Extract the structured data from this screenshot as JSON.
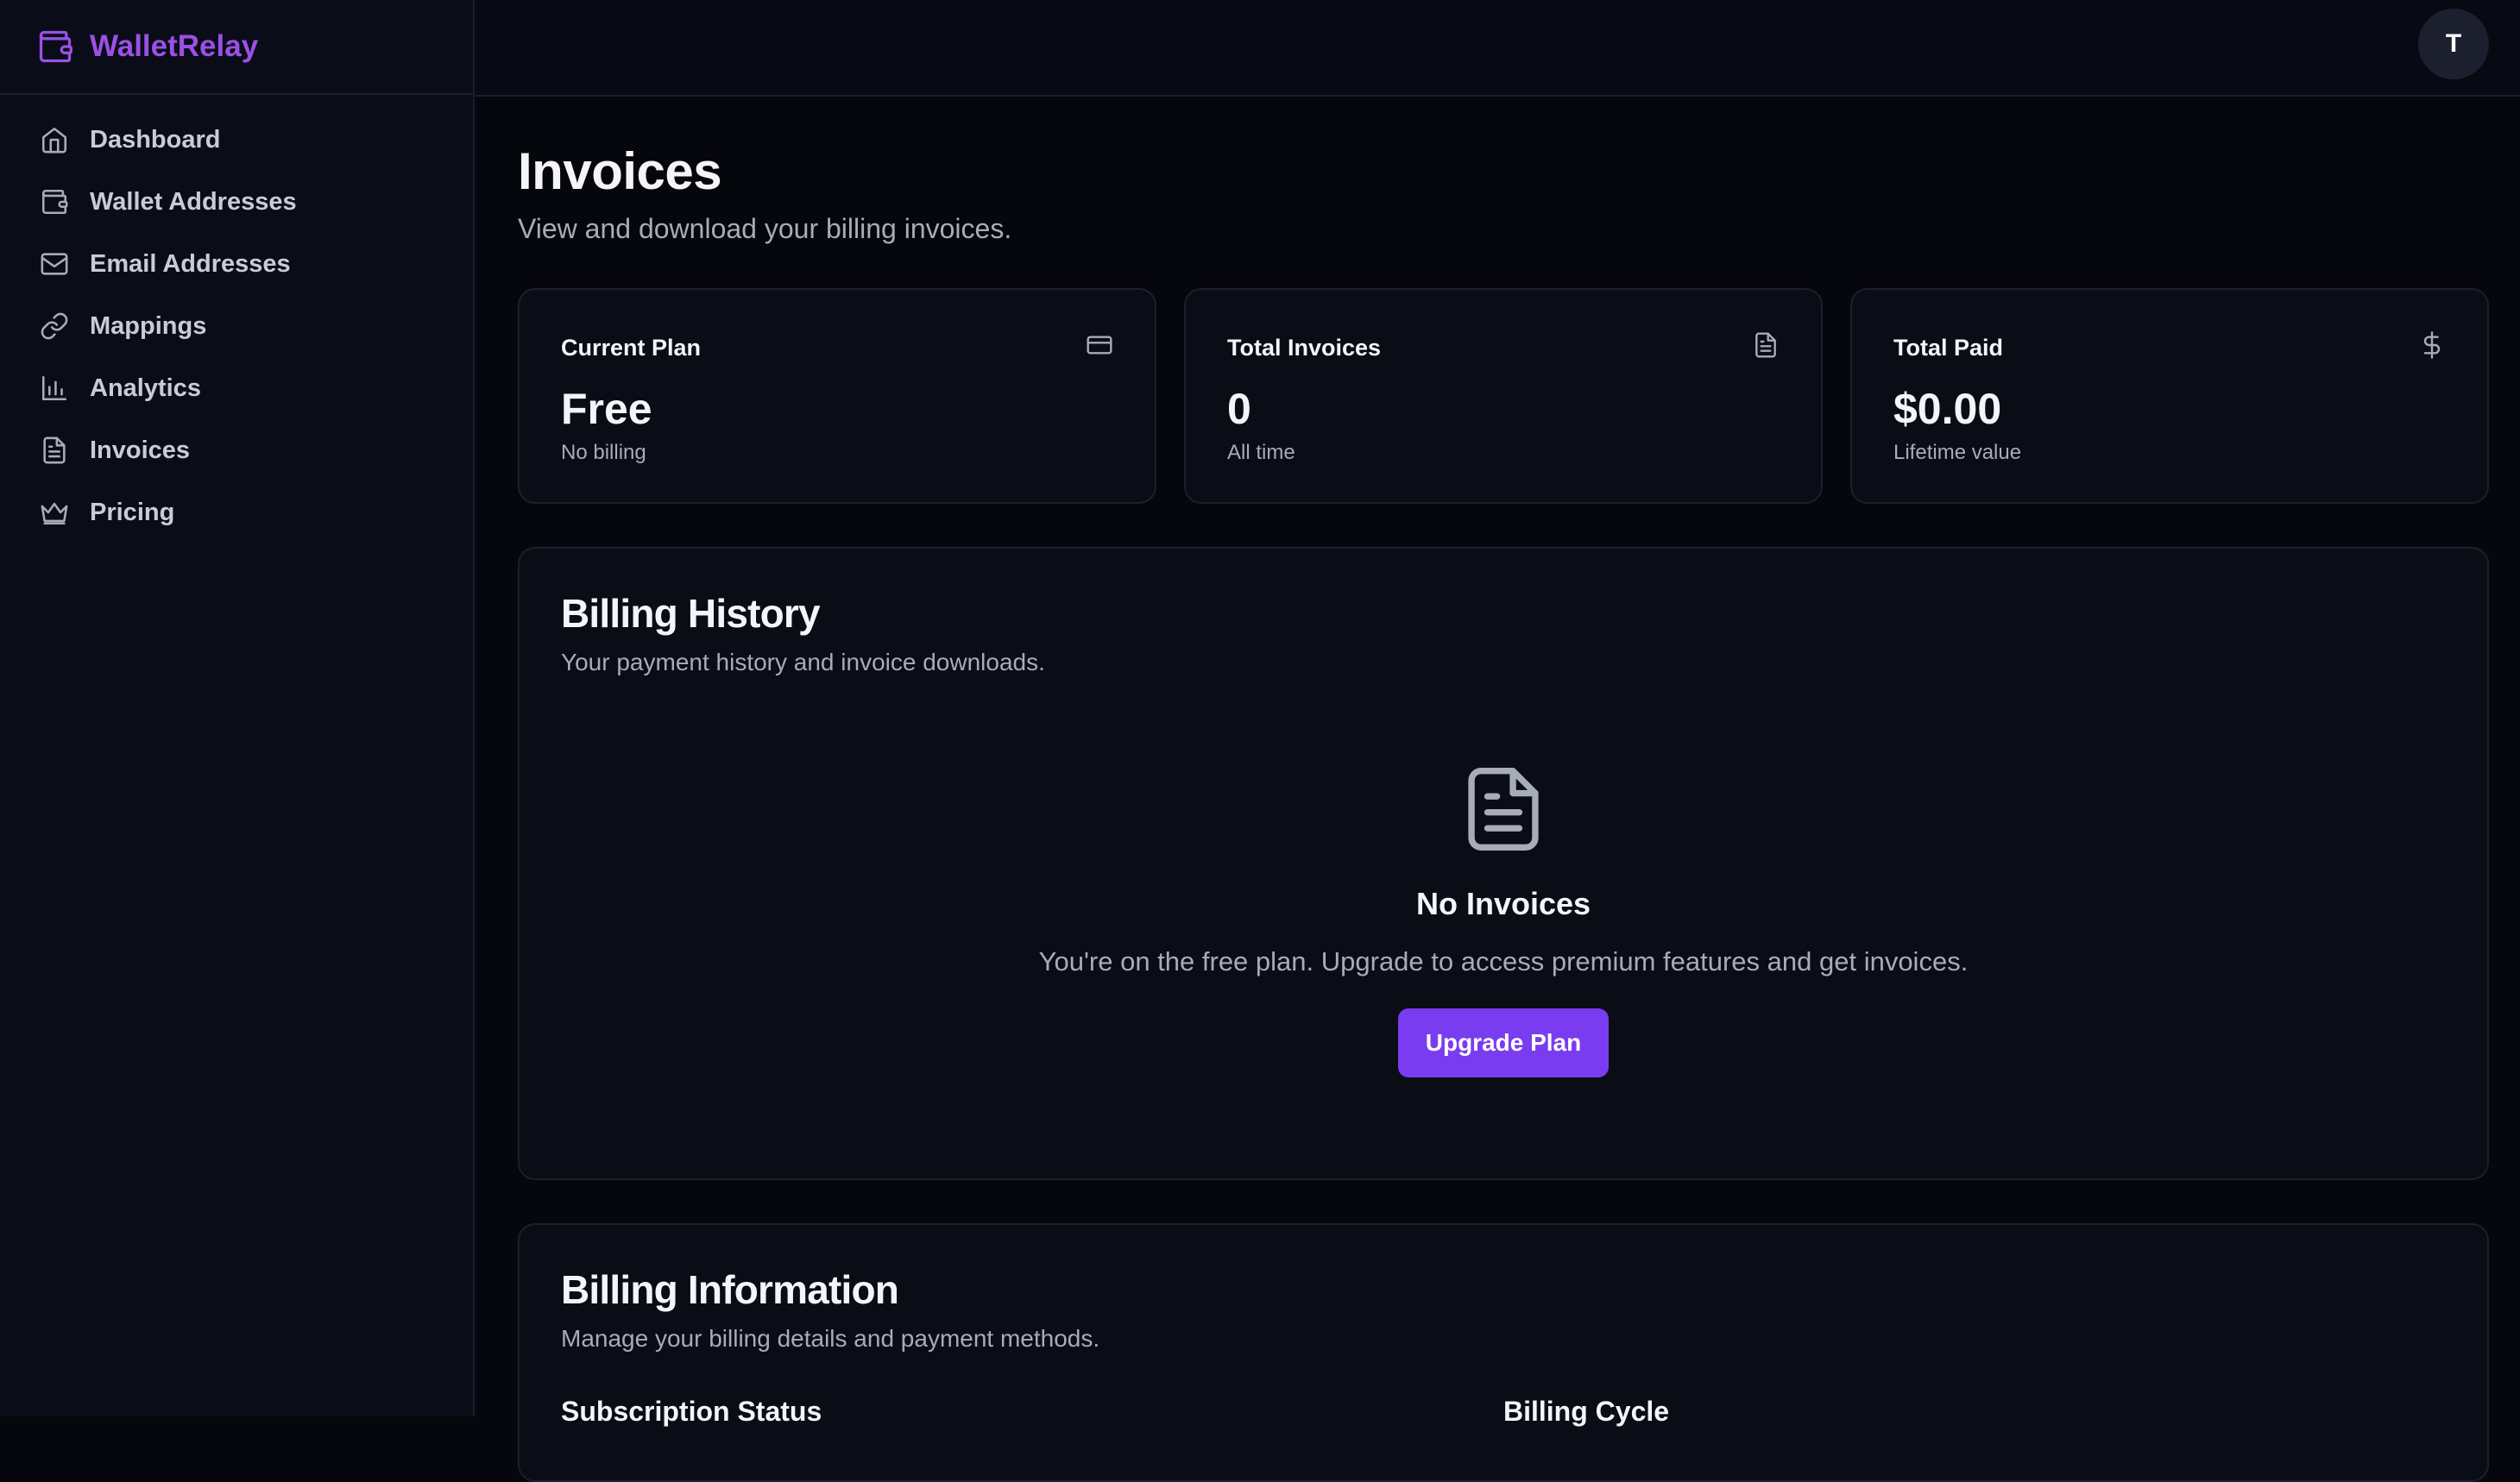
{
  "brand": {
    "name": "WalletRelay",
    "color": "#9b50e6"
  },
  "sidebar": {
    "items": [
      {
        "label": "Dashboard",
        "icon": "home-icon"
      },
      {
        "label": "Wallet Addresses",
        "icon": "wallet-icon"
      },
      {
        "label": "Email Addresses",
        "icon": "mail-icon"
      },
      {
        "label": "Mappings",
        "icon": "link-icon"
      },
      {
        "label": "Analytics",
        "icon": "bar-chart-icon"
      },
      {
        "label": "Invoices",
        "icon": "file-text-icon"
      },
      {
        "label": "Pricing",
        "icon": "crown-icon"
      }
    ]
  },
  "topbar": {
    "avatar_initial": "T"
  },
  "page": {
    "title": "Invoices",
    "subtitle": "View and download your billing invoices."
  },
  "stats": [
    {
      "label": "Current Plan",
      "value": "Free",
      "sub": "No billing",
      "icon": "credit-card-icon"
    },
    {
      "label": "Total Invoices",
      "value": "0",
      "sub": "All time",
      "icon": "file-text-icon"
    },
    {
      "label": "Total Paid",
      "value": "$0.00",
      "sub": "Lifetime value",
      "icon": "dollar-icon"
    }
  ],
  "billing_history": {
    "title": "Billing History",
    "description": "Your payment history and invoice downloads.",
    "empty_title": "No Invoices",
    "empty_text": "You're on the free plan. Upgrade to access premium features and get invoices.",
    "button_label": "Upgrade Plan",
    "button_color": "#7a3cf0"
  },
  "billing_info": {
    "title": "Billing Information",
    "description": "Manage your billing details and payment methods.",
    "col_left": "Subscription Status",
    "col_right": "Billing Cycle"
  }
}
